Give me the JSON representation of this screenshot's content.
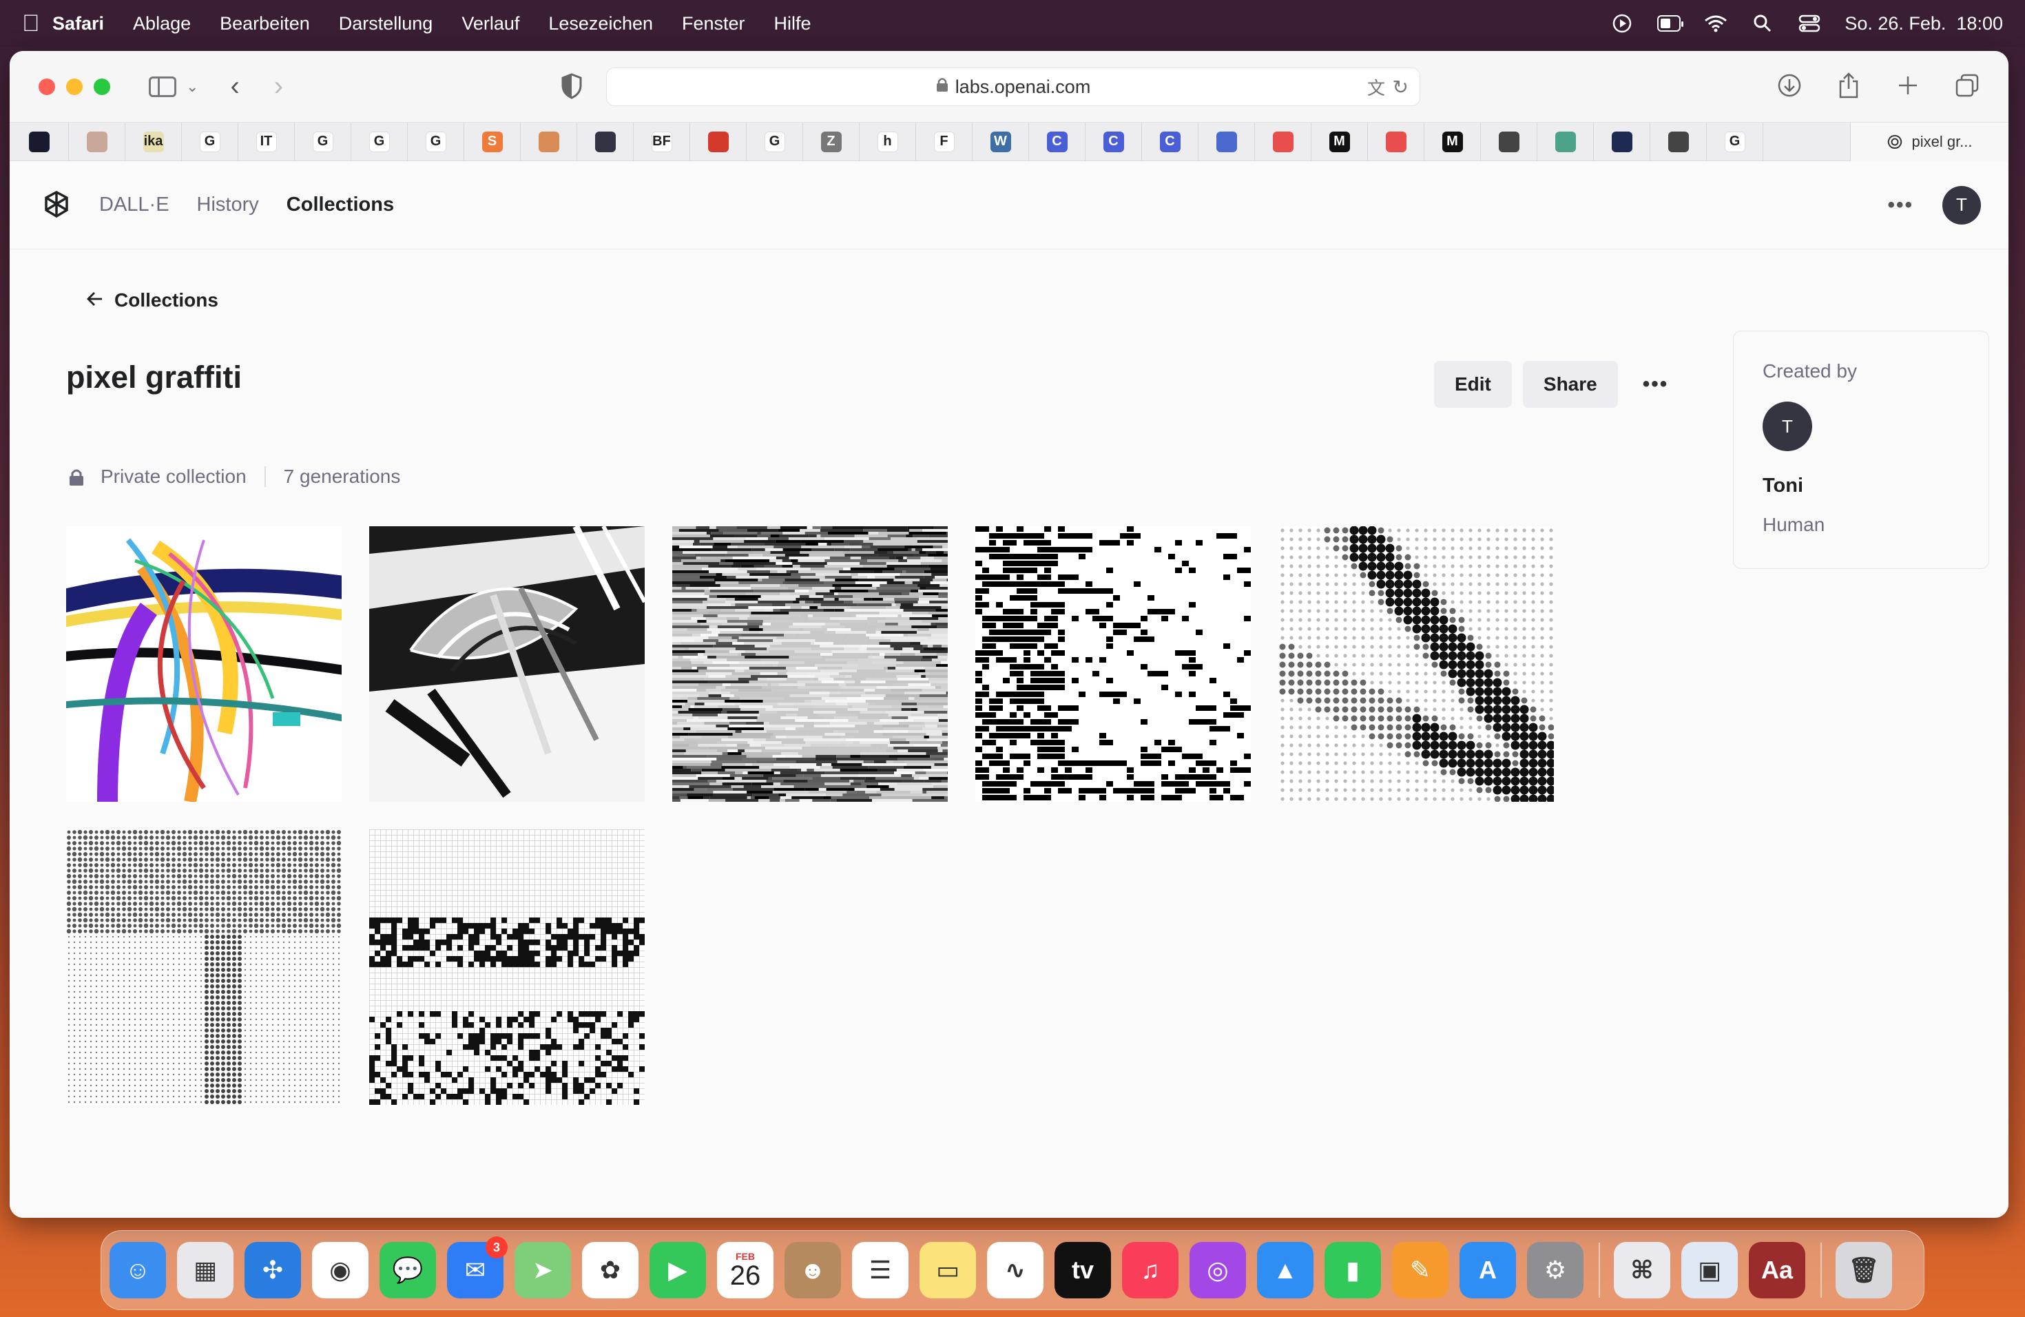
{
  "menubar": {
    "app": "Safari",
    "items": [
      "Ablage",
      "Bearbeiten",
      "Darstellung",
      "Verlauf",
      "Lesezeichen",
      "Fenster",
      "Hilfe"
    ],
    "datetime": "So. 26. Feb.  18:00",
    "battery_level": 0.35
  },
  "browser": {
    "url": "labs.openai.com",
    "active_tab_title": "pixel gr...",
    "favorites": [
      {
        "glyph": "",
        "color": "#1a1a2e"
      },
      {
        "glyph": "",
        "color": "#c9a89a"
      },
      {
        "glyph": "ika",
        "color": "#e8e0b0"
      },
      {
        "glyph": "G",
        "color": "#ffffff"
      },
      {
        "glyph": "IT",
        "color": "#ffffff"
      },
      {
        "glyph": "G",
        "color": "#ffffff"
      },
      {
        "glyph": "G",
        "color": "#ffffff"
      },
      {
        "glyph": "G",
        "color": "#ffffff"
      },
      {
        "glyph": "S",
        "color": "#f07a3a"
      },
      {
        "glyph": "",
        "color": "#d98c55"
      },
      {
        "glyph": "",
        "color": "#333344"
      },
      {
        "glyph": "BF",
        "color": "#ffffff"
      },
      {
        "glyph": "",
        "color": "#d33a2c"
      },
      {
        "glyph": "G",
        "color": "#ffffff"
      },
      {
        "glyph": "Z",
        "color": "#777777"
      },
      {
        "glyph": "h",
        "color": "#ffffff"
      },
      {
        "glyph": "F",
        "color": "#ffffff"
      },
      {
        "glyph": "W",
        "color": "#3d6fa6"
      },
      {
        "glyph": "C",
        "color": "#4a5ed8"
      },
      {
        "glyph": "C",
        "color": "#4a5ed8"
      },
      {
        "glyph": "C",
        "color": "#4a5ed8"
      },
      {
        "glyph": "",
        "color": "#4a6ad0"
      },
      {
        "glyph": "",
        "color": "#e84e4e"
      },
      {
        "glyph": "M",
        "color": "#111111"
      },
      {
        "glyph": "",
        "color": "#e84e4e"
      },
      {
        "glyph": "M",
        "color": "#111111"
      },
      {
        "glyph": "",
        "color": "#444444"
      },
      {
        "glyph": "",
        "color": "#4aa38a"
      },
      {
        "glyph": "",
        "color": "#1d2a52"
      },
      {
        "glyph": "",
        "color": "#444444"
      },
      {
        "glyph": "G",
        "color": "#ffffff"
      }
    ]
  },
  "app_header": {
    "nav": [
      "DALL·E",
      "History",
      "Collections"
    ],
    "active_nav": "Collections",
    "avatar_initial": "T"
  },
  "collection": {
    "back_label": "Collections",
    "title": "pixel graffiti",
    "edit_label": "Edit",
    "share_label": "Share",
    "visibility": "Private collection",
    "count_label": "7 generations"
  },
  "creator": {
    "label": "Created by",
    "initial": "T",
    "name": "Toni",
    "type": "Human"
  },
  "generations": [
    {
      "style": "colorful-ribbons"
    },
    {
      "style": "chrome-sculpture"
    },
    {
      "style": "glitch-streaks"
    },
    {
      "style": "pixel-noise"
    },
    {
      "style": "halftone-diagonal"
    },
    {
      "style": "halftone-t"
    },
    {
      "style": "grid-glyphs"
    }
  ],
  "dock": {
    "mail_badge": "3",
    "calendar_month": "FEB",
    "calendar_day": "26",
    "apps": [
      {
        "name": "finder",
        "color": "#3a8ef0",
        "glyph": "☺"
      },
      {
        "name": "launchpad",
        "color": "#e8e8ec",
        "glyph": "▦"
      },
      {
        "name": "safari",
        "color": "#2a7de0",
        "glyph": "✣"
      },
      {
        "name": "chrome",
        "color": "#ffffff",
        "glyph": "◉"
      },
      {
        "name": "messages",
        "color": "#34c759",
        "glyph": "💬"
      },
      {
        "name": "mail",
        "color": "#2f7df6",
        "glyph": "✉"
      },
      {
        "name": "maps",
        "color": "#7fcf7a",
        "glyph": "➤"
      },
      {
        "name": "photos",
        "color": "#ffffff",
        "glyph": "✿"
      },
      {
        "name": "facetime",
        "color": "#34c759",
        "glyph": "▶"
      },
      {
        "name": "calendar",
        "color": "#ffffff",
        "glyph": ""
      },
      {
        "name": "contacts",
        "color": "#b58a5e",
        "glyph": "☻"
      },
      {
        "name": "reminders",
        "color": "#ffffff",
        "glyph": "☰"
      },
      {
        "name": "notes",
        "color": "#fbe27a",
        "glyph": "▭"
      },
      {
        "name": "freeform",
        "color": "#ffffff",
        "glyph": "∿"
      },
      {
        "name": "tv",
        "color": "#111111",
        "glyph": "tv"
      },
      {
        "name": "music",
        "color": "#fa3e5a",
        "glyph": "♫"
      },
      {
        "name": "podcasts",
        "color": "#a347e6",
        "glyph": "◎"
      },
      {
        "name": "keynote",
        "color": "#2f8ef4",
        "glyph": "▲"
      },
      {
        "name": "numbers",
        "color": "#32c95b",
        "glyph": "▮"
      },
      {
        "name": "pages",
        "color": "#f79a2e",
        "glyph": "✎"
      },
      {
        "name": "appstore",
        "color": "#2f8ef4",
        "glyph": "A"
      },
      {
        "name": "settings",
        "color": "#8e8e93",
        "glyph": "⚙"
      },
      {
        "name": "automator",
        "color": "#e9e9ee",
        "glyph": "⌘"
      },
      {
        "name": "preview",
        "color": "#dfe8f5",
        "glyph": "▣"
      },
      {
        "name": "dictionary",
        "color": "#9b2c2c",
        "glyph": "Aa"
      },
      {
        "name": "trash",
        "color": "#d8d8dc",
        "glyph": "🗑"
      }
    ]
  }
}
